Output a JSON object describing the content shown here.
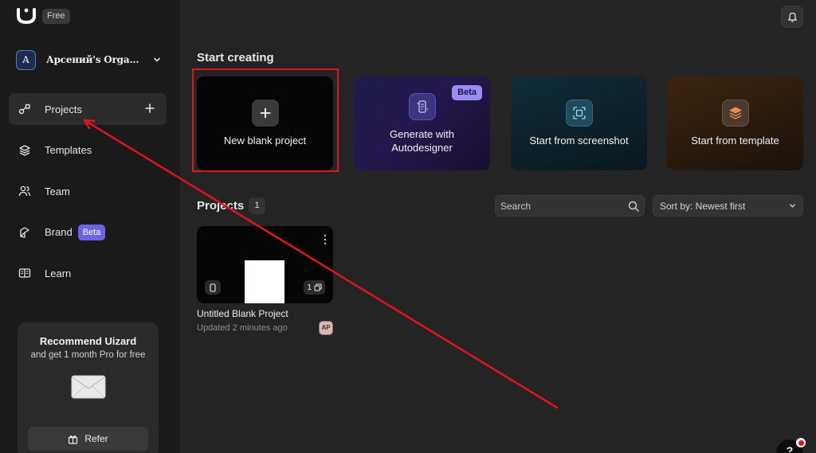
{
  "app": {
    "plan_badge": "Free"
  },
  "org": {
    "initial": "A",
    "name": "Арсений's Orga..."
  },
  "sidebar": {
    "items": [
      {
        "label": "Projects",
        "icon": "projects-icon"
      },
      {
        "label": "Templates",
        "icon": "layers-icon"
      },
      {
        "label": "Team",
        "icon": "team-icon"
      },
      {
        "label": "Brand",
        "icon": "brand-icon",
        "badge": "Beta"
      },
      {
        "label": "Learn",
        "icon": "book-icon"
      }
    ]
  },
  "recommend": {
    "title": "Recommend Uizard",
    "subtitle": "and get 1 month Pro for free",
    "button": "Refer"
  },
  "start": {
    "title": "Start creating",
    "cards": [
      {
        "label": "New blank project",
        "icon": "plus-icon"
      },
      {
        "label": "Generate with Autodesigner",
        "icon": "autodesigner-icon",
        "badge": "Beta"
      },
      {
        "label": "Start from screenshot",
        "icon": "screenshot-icon"
      },
      {
        "label": "Start from template",
        "icon": "template-icon"
      }
    ]
  },
  "projects": {
    "title": "Projects",
    "count": "1",
    "search_placeholder": "Search",
    "sort_label": "Sort by: Newest first",
    "items": [
      {
        "name": "Untitled Blank Project",
        "updated": "Updated 2 minutes ago",
        "pages": "1",
        "user_initials": "AP"
      }
    ]
  },
  "help": {
    "label": "?"
  },
  "colors": {
    "accent": "#6e63e6",
    "annotation": "#e0141c",
    "background": "#242424",
    "sidebar": "#1a1a1a"
  }
}
